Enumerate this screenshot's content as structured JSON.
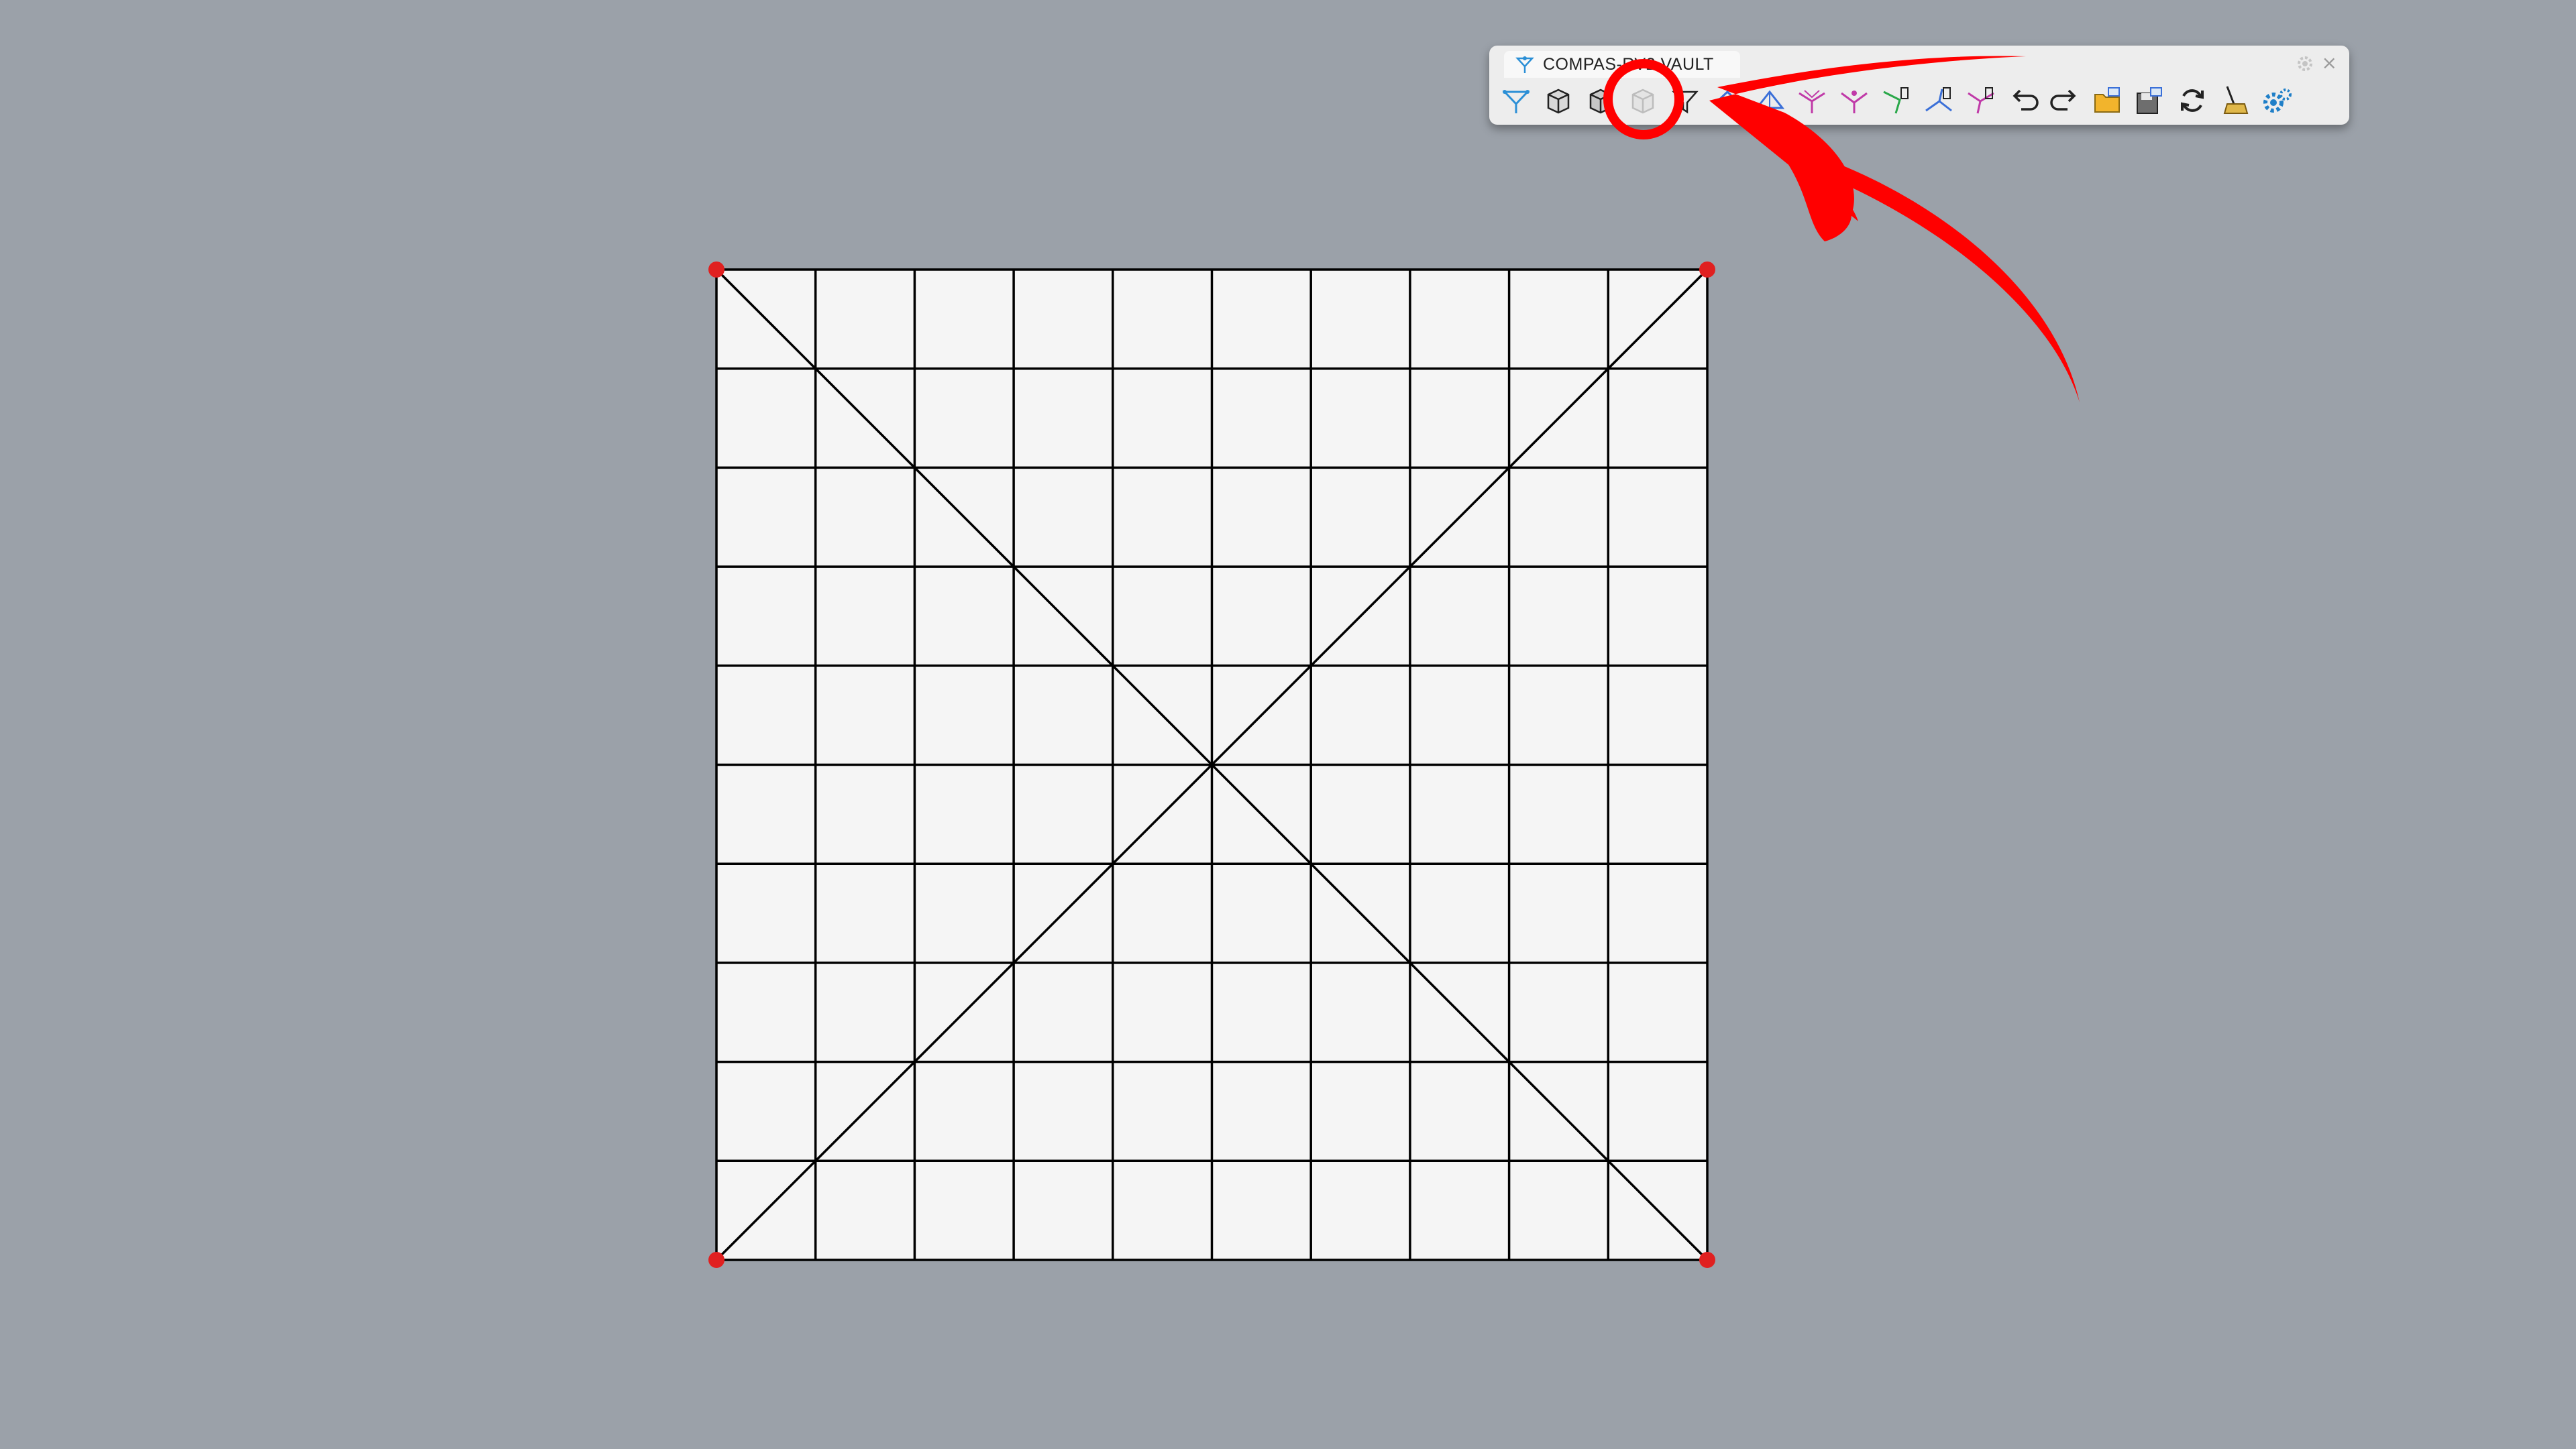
{
  "toolbar": {
    "title": "COMPAS-RV2 VAULT",
    "tools": [
      {
        "name": "rv2-init-tool",
        "icon": "rv2-logo-icon"
      },
      {
        "name": "pattern-from-mesh-tool",
        "icon": "box-mesh-icon"
      },
      {
        "name": "pattern-from-surface-tool",
        "icon": "box-surface-icon"
      },
      {
        "name": "pattern-from-skeleton-tool",
        "icon": "pattern-box-icon"
      },
      {
        "name": "boundaries-tool",
        "icon": "funnel-icon"
      },
      {
        "name": "form-tool",
        "icon": "form-diagram-icon"
      },
      {
        "name": "force-tool",
        "icon": "force-diagram-icon"
      },
      {
        "name": "thrust-tool",
        "icon": "thrust-diagram-icon"
      },
      {
        "name": "modify-form-tool",
        "icon": "modify-form-icon"
      },
      {
        "name": "modify-force-tool",
        "icon": "modify-force-icon"
      },
      {
        "name": "modify-thrust-tool",
        "icon": "modify-thrust-icon"
      },
      {
        "name": "modify-pattern-tool",
        "icon": "modify-pattern-icon"
      },
      {
        "name": "undo-tool",
        "icon": "undo-icon"
      },
      {
        "name": "redo-tool",
        "icon": "redo-icon"
      },
      {
        "name": "open-file-tool",
        "icon": "open-folder-icon"
      },
      {
        "name": "save-file-tool",
        "icon": "save-disk-icon"
      },
      {
        "name": "reload-tool",
        "icon": "reload-icon"
      },
      {
        "name": "clear-tool",
        "icon": "broom-icon"
      },
      {
        "name": "settings-tool",
        "icon": "settings-gear-icon"
      }
    ]
  },
  "mesh": {
    "divisions": 10,
    "face_color": "#f5f5f5",
    "edge_color": "#000000",
    "support_color": "#e02020",
    "supports": [
      "top-left",
      "top-right",
      "bottom-left",
      "bottom-right"
    ]
  },
  "annotation": {
    "color": "#ff0000",
    "highlighted_tool": "pattern-from-skeleton-tool"
  },
  "colors": {
    "background": "#9ba1a9",
    "toolbar_bg": "#ededed"
  }
}
